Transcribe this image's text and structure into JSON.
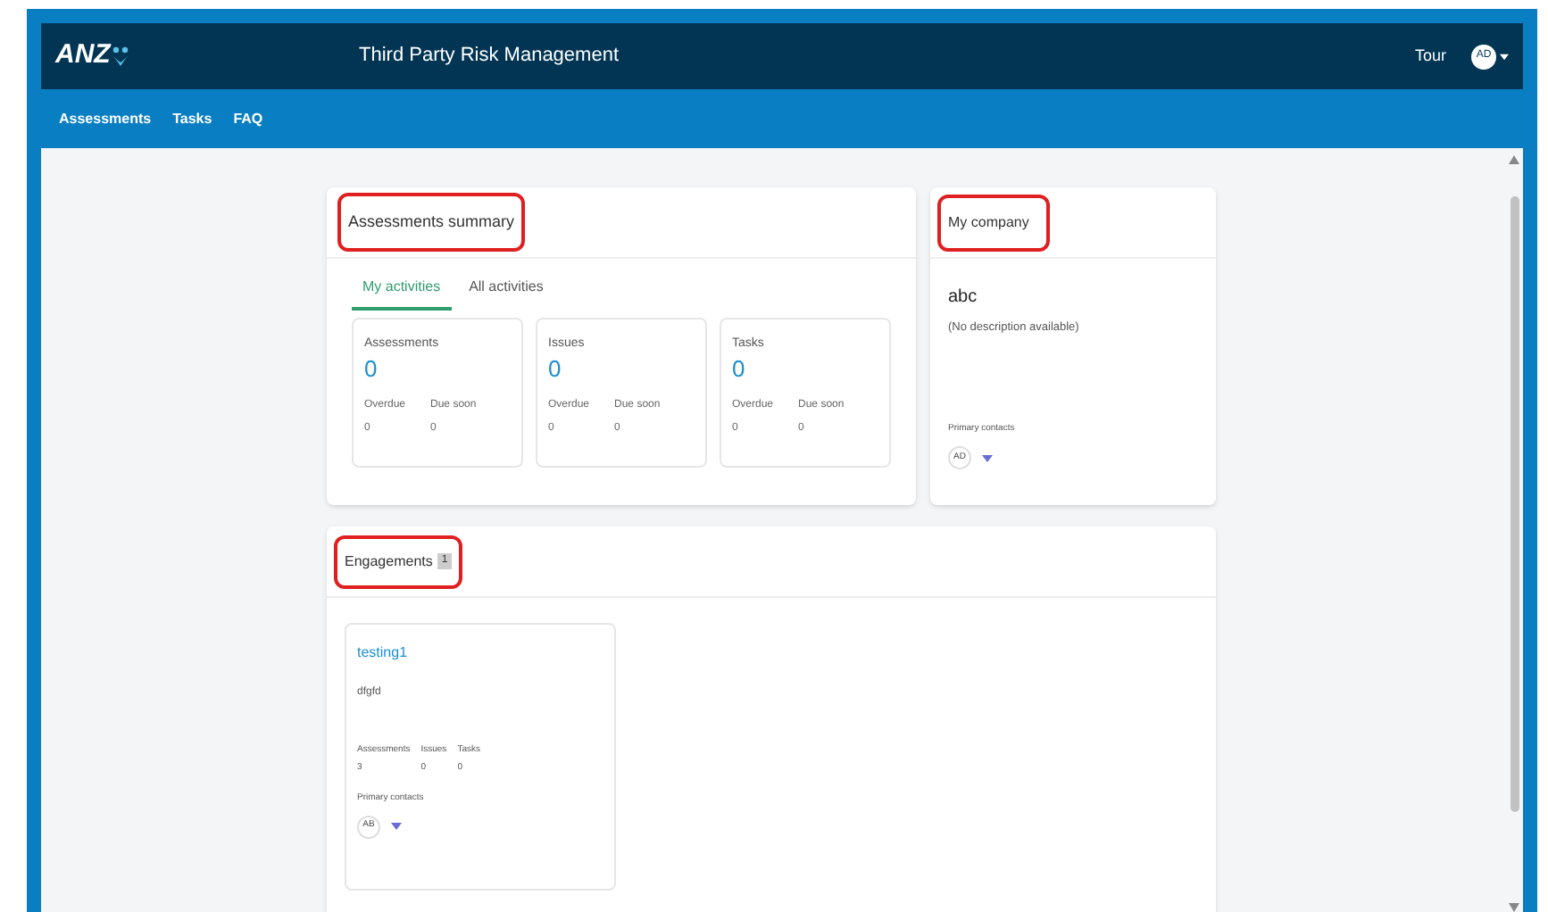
{
  "header": {
    "logo": "ANZ",
    "title": "Third Party Risk Management",
    "tour": "Tour",
    "avatar": "AD"
  },
  "nav": [
    {
      "label": "Assessments"
    },
    {
      "label": "Tasks"
    },
    {
      "label": "FAQ"
    }
  ],
  "summary": {
    "title": "Assessments summary",
    "tabs": [
      {
        "label": "My activities",
        "selected": true
      },
      {
        "label": "All activities",
        "selected": false
      }
    ],
    "cards": [
      {
        "title": "Assessments",
        "count": "0",
        "overdue_label": "Overdue",
        "overdue": "0",
        "due_label": "Due soon",
        "due": "0"
      },
      {
        "title": "Issues",
        "count": "0",
        "overdue_label": "Overdue",
        "overdue": "0",
        "due_label": "Due soon",
        "due": "0"
      },
      {
        "title": "Tasks",
        "count": "0",
        "overdue_label": "Overdue",
        "overdue": "0",
        "due_label": "Due soon",
        "due": "0"
      }
    ]
  },
  "company": {
    "title": "My company",
    "name": "abc",
    "description": "(No description available)",
    "contacts_label": "Primary contacts",
    "avatar": "AD"
  },
  "engagements": {
    "title": "Engagements",
    "count": "1",
    "items": [
      {
        "name": "testing1",
        "description": "dfgfd",
        "stats": [
          {
            "label": "Assessments",
            "value": "3"
          },
          {
            "label": "Issues",
            "value": "0"
          },
          {
            "label": "Tasks",
            "value": "0"
          }
        ],
        "contacts_label": "Primary contacts",
        "avatar": "AB"
      }
    ]
  }
}
